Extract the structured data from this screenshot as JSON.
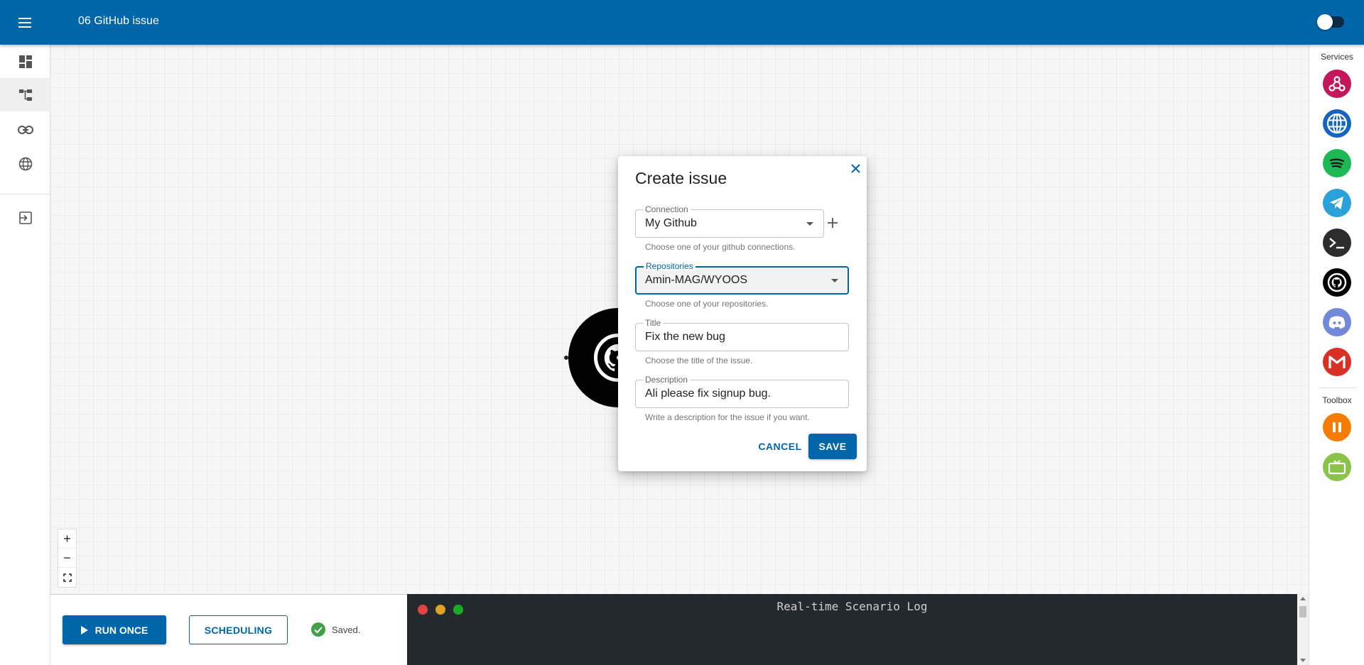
{
  "header": {
    "title": "06 GitHub issue"
  },
  "nav": {
    "items": [
      {
        "name": "dashboard-icon"
      },
      {
        "name": "scenarios-icon"
      },
      {
        "name": "connections-icon"
      },
      {
        "name": "globe-icon"
      },
      {
        "name": "logout-icon"
      }
    ],
    "active_index": 1
  },
  "node": {
    "service": "GitHub"
  },
  "zoom": {
    "in": "+",
    "out": "−"
  },
  "dialog": {
    "title": "Create issue",
    "fields": {
      "connection": {
        "label": "Connection",
        "value": "My Github",
        "helper": "Choose one of your github connections."
      },
      "repositories": {
        "label": "Repositories",
        "value": "Amin-MAG/WYOOS",
        "helper": "Choose one of your repositories."
      },
      "title": {
        "label": "Title",
        "value": "Fix the new bug",
        "helper": "Choose the title of the issue."
      },
      "description": {
        "label": "Description",
        "value": "Ali please fix signup bug.",
        "helper": "Write a description for the issue if you want."
      }
    },
    "cancel_label": "CANCEL",
    "save_label": "SAVE"
  },
  "right_panel": {
    "services_heading": "Services",
    "services": [
      {
        "name": "webhook",
        "color": "#c2185b"
      },
      {
        "name": "http",
        "color": "#1565c0"
      },
      {
        "name": "spotify",
        "color": "#1db954"
      },
      {
        "name": "telegram",
        "color": "#2aa1da"
      },
      {
        "name": "terminal",
        "color": "#2d2d2d"
      },
      {
        "name": "github",
        "color": "#000000"
      },
      {
        "name": "discord",
        "color": "#7289da"
      },
      {
        "name": "gmail",
        "color": "#d93025"
      }
    ],
    "toolbox_heading": "Toolbox",
    "toolbox": [
      {
        "name": "pause",
        "color": "#f57c00"
      },
      {
        "name": "repeat",
        "color": "#8bc34a"
      }
    ]
  },
  "bottom": {
    "run_label": "RUN ONCE",
    "scheduling_label": "SCHEDULING",
    "saved_text": "Saved."
  },
  "log": {
    "title": "Real-time Scenario Log"
  },
  "colors": {
    "primary": "#0066aa",
    "log_bg": "#24292e"
  }
}
